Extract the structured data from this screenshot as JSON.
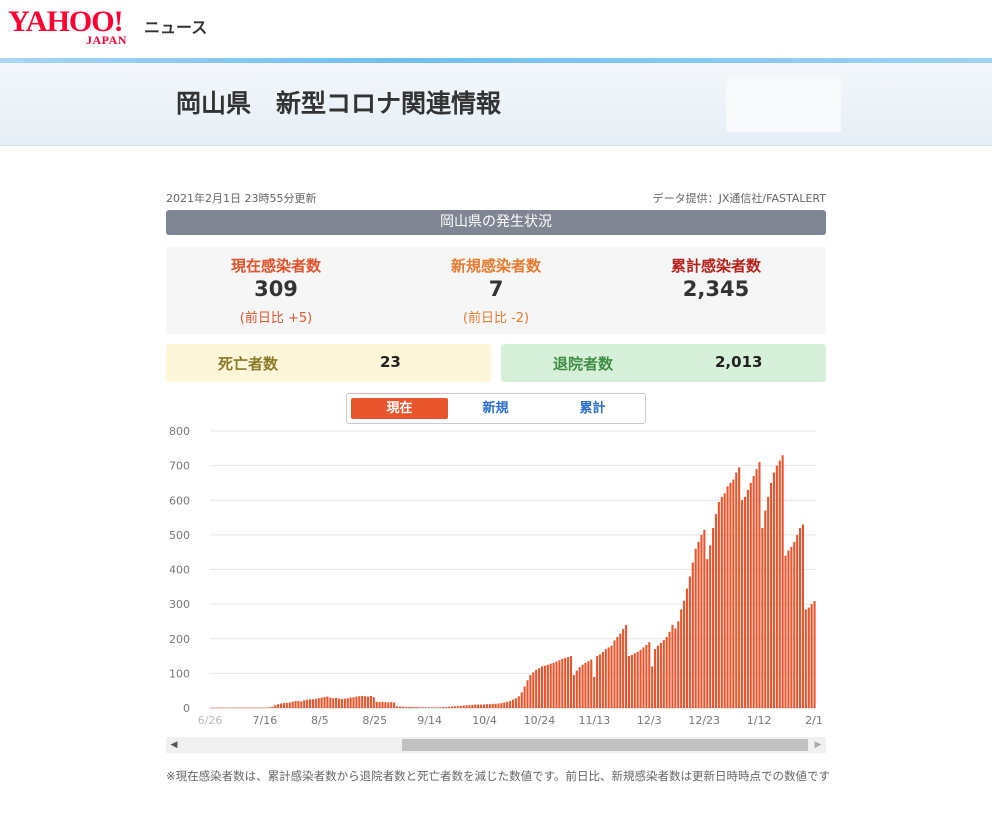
{
  "header": {
    "logo_text": "YAHOO!",
    "logo_sub": "JAPAN",
    "service": "ニュース",
    "page_title": "岡山県　新型コロナ関連情報"
  },
  "meta": {
    "updated": "2021年2月1日 23時55分更新",
    "provider": "データ提供：JX通信社/FASTALERT"
  },
  "section_title": "岡山県の発生状況",
  "stats": {
    "current": {
      "label": "現在感染者数",
      "value": "309",
      "compare": "(前日比 +5)"
    },
    "new": {
      "label": "新規感染者数",
      "value": "7",
      "compare": "(前日比 -2)"
    },
    "cumulative": {
      "label": "累計感染者数",
      "value": "2,345"
    }
  },
  "deaths": {
    "label": "死亡者数",
    "value": "23"
  },
  "recovered": {
    "label": "退院者数",
    "value": "2,013"
  },
  "tabs": [
    {
      "label": "現在",
      "active": true
    },
    {
      "label": "新規",
      "active": false
    },
    {
      "label": "累計",
      "active": false
    }
  ],
  "colors": {
    "bar": "#e9552c",
    "tab_active": "#e9552c",
    "tab_text": "#2a6fd0",
    "section_bar": "#7f8592"
  },
  "chart_data": {
    "type": "bar",
    "title": "",
    "ylim": [
      0,
      800
    ],
    "yticks": [
      0,
      100,
      200,
      300,
      400,
      500,
      600,
      700,
      800
    ],
    "xtick_labels": [
      "6/26",
      "7/16",
      "8/5",
      "8/25",
      "9/14",
      "10/4",
      "10/24",
      "11/13",
      "12/3",
      "12/23",
      "1/12",
      "2/1"
    ],
    "x_start": "6/26",
    "x_end": "2/1",
    "values": [
      1,
      1,
      1,
      1,
      1,
      1,
      1,
      1,
      1,
      1,
      1,
      1,
      1,
      1,
      1,
      1,
      1,
      1,
      1,
      1,
      2,
      4,
      8,
      11,
      13,
      14,
      15,
      16,
      18,
      20,
      20,
      19,
      22,
      24,
      25,
      25,
      26,
      28,
      30,
      32,
      33,
      30,
      28,
      29,
      27,
      26,
      27,
      28,
      30,
      31,
      33,
      34,
      35,
      34,
      33,
      35,
      31,
      18,
      17,
      18,
      17,
      16,
      17,
      16,
      5,
      4,
      4,
      3,
      3,
      3,
      3,
      3,
      2,
      2,
      2,
      2,
      2,
      2,
      2,
      2,
      3,
      3,
      4,
      4,
      5,
      5,
      6,
      7,
      8,
      8,
      9,
      10,
      10,
      10,
      10,
      11,
      11,
      12,
      12,
      13,
      14,
      16,
      18,
      20,
      24,
      28,
      34,
      45,
      62,
      80,
      95,
      103,
      110,
      115,
      120,
      122,
      125,
      128,
      130,
      134,
      138,
      142,
      145,
      147,
      150,
      95,
      108,
      118,
      125,
      130,
      135,
      140,
      90,
      150,
      155,
      162,
      170,
      175,
      180,
      195,
      205,
      215,
      228,
      240,
      150,
      153,
      158,
      162,
      168,
      175,
      182,
      190,
      120,
      170,
      180,
      188,
      196,
      205,
      220,
      240,
      230,
      250,
      285,
      310,
      345,
      380,
      420,
      460,
      480,
      500,
      515,
      430,
      470,
      520,
      560,
      595,
      610,
      620,
      640,
      650,
      660,
      680,
      695,
      600,
      610,
      630,
      650,
      670,
      690,
      710,
      520,
      570,
      610,
      650,
      680,
      700,
      715,
      730,
      440,
      455,
      465,
      480,
      500,
      520,
      530,
      285,
      290,
      300,
      309
    ]
  },
  "scrollbar": {
    "left_arrow": "◀",
    "right_arrow": "▶"
  },
  "footnote": "※現在感染者数は、累計感染者数から退院者数と死亡者数を減じた数値です。前日比、新規感染者数は更新日時時点での数値です"
}
